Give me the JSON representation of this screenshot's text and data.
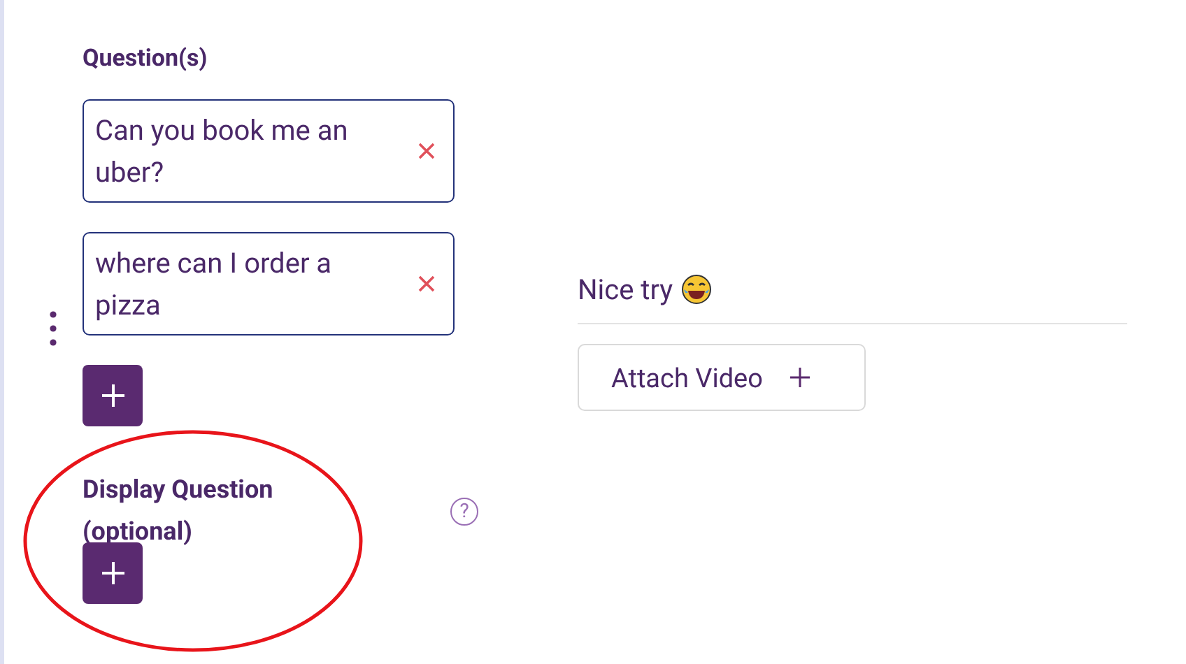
{
  "questions_section": {
    "title": "Question(s)",
    "questions": [
      {
        "text": "Can you book me an uber?"
      },
      {
        "text": "where can I order a pizza"
      }
    ]
  },
  "display_question": {
    "label": "Display Question (optional)",
    "help": "?"
  },
  "answer": {
    "text": "Nice try",
    "attach_button": "Attach Video"
  }
}
